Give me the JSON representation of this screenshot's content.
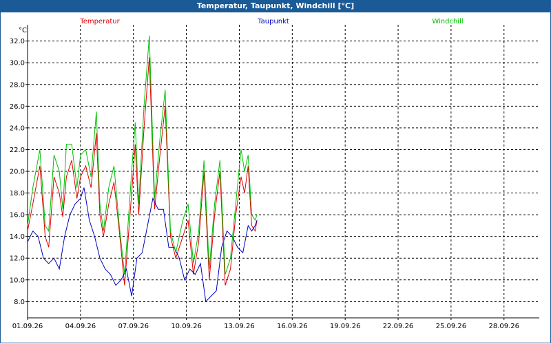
{
  "window": {
    "title": "Temperatur, Taupunkt, Windchill [°C]"
  },
  "chart_data": {
    "type": "line",
    "title": "Temperatur, Taupunkt, Windchill [°C]",
    "ylabel": "°C",
    "xlabel": "",
    "ylim": [
      6.5,
      33.5
    ],
    "xlim": [
      0,
      29
    ],
    "grid": true,
    "legend_placement": "top",
    "yticks": [
      "8.0",
      "10.0",
      "12.0",
      "14.0",
      "16.0",
      "18.0",
      "20.0",
      "22.0",
      "24.0",
      "26.0",
      "28.0",
      "30.0",
      "32.0"
    ],
    "ytick_values": [
      8,
      10,
      12,
      14,
      16,
      18,
      20,
      22,
      24,
      26,
      28,
      30,
      32
    ],
    "xticks": [
      "01.09.26",
      "04.09.26",
      "07.09.26",
      "10.09.26",
      "13.09.26",
      "16.09.26",
      "19.09.26",
      "22.09.26",
      "25.09.26",
      "28.09.26"
    ],
    "xtick_values": [
      0,
      3,
      6,
      9,
      12,
      15,
      18,
      21,
      24,
      27
    ],
    "series": [
      {
        "name": "Temperatur",
        "color": "#e00000",
        "x": [
          0,
          0.3,
          0.7,
          1.0,
          1.2,
          1.5,
          1.8,
          2.0,
          2.2,
          2.5,
          2.8,
          3.0,
          3.3,
          3.6,
          3.9,
          4.1,
          4.3,
          4.6,
          4.9,
          5.2,
          5.5,
          5.9,
          6.1,
          6.3,
          6.6,
          6.9,
          7.2,
          7.5,
          7.8,
          8.1,
          8.4,
          8.8,
          9.1,
          9.4,
          9.7,
          10.0,
          10.3,
          10.6,
          10.9,
          11.2,
          11.5,
          11.8,
          12.1,
          12.3,
          12.5,
          12.7,
          12.9,
          13.0
        ],
        "values": [
          14.5,
          17,
          20.5,
          14,
          13,
          19.5,
          18,
          15.8,
          19.5,
          21,
          17.5,
          19.5,
          20.5,
          18.5,
          23.5,
          16,
          14,
          17,
          19,
          14.5,
          9.5,
          18,
          22.5,
          16,
          24,
          30.5,
          16.5,
          21.5,
          26,
          14,
          12,
          14,
          15.5,
          10.5,
          13.5,
          20,
          10,
          16,
          20,
          9.5,
          11,
          16,
          19.5,
          18,
          20.5,
          15,
          14.5,
          15.5
        ]
      },
      {
        "name": "Taupunkt",
        "color": "#0000c0",
        "x": [
          0,
          0.3,
          0.6,
          0.9,
          1.2,
          1.5,
          1.8,
          2.1,
          2.4,
          2.7,
          3.0,
          3.2,
          3.5,
          3.8,
          4.1,
          4.4,
          4.7,
          5.0,
          5.3,
          5.6,
          5.9,
          6.2,
          6.5,
          6.8,
          7.1,
          7.4,
          7.7,
          8.0,
          8.3,
          8.6,
          8.9,
          9.2,
          9.5,
          9.8,
          10.1,
          10.4,
          10.7,
          11.0,
          11.3,
          11.6,
          11.9,
          12.2,
          12.5,
          12.7,
          12.9,
          13.0
        ],
        "values": [
          13.5,
          14.5,
          14,
          12,
          11.5,
          12,
          11,
          14,
          16,
          17,
          17.5,
          18.5,
          15.5,
          14,
          12,
          11,
          10.5,
          9.5,
          10,
          11,
          8.5,
          12,
          12.5,
          15,
          17.5,
          16.5,
          16.5,
          13,
          13,
          12,
          10,
          11,
          10.5,
          11.5,
          8,
          8.5,
          9,
          13,
          14.5,
          14,
          13,
          12.5,
          15,
          14.5,
          15,
          15.5
        ]
      },
      {
        "name": "Windchill",
        "color": "#00c000",
        "x": [
          0,
          0.3,
          0.7,
          1.0,
          1.2,
          1.5,
          1.8,
          2.0,
          2.2,
          2.5,
          2.8,
          3.0,
          3.3,
          3.6,
          3.9,
          4.1,
          4.3,
          4.6,
          4.9,
          5.2,
          5.5,
          5.9,
          6.1,
          6.3,
          6.6,
          6.9,
          7.2,
          7.5,
          7.8,
          8.1,
          8.4,
          8.8,
          9.1,
          9.4,
          9.7,
          10.0,
          10.3,
          10.6,
          10.9,
          11.2,
          11.5,
          11.8,
          12.1,
          12.3,
          12.5,
          12.7,
          12.9,
          13.0
        ],
        "values": [
          15,
          18.5,
          22,
          15,
          14.5,
          21.5,
          20,
          16.5,
          22.5,
          22.5,
          18.5,
          21.5,
          22,
          19.5,
          25.5,
          17,
          14.5,
          18.5,
          20.5,
          15,
          10.5,
          20,
          24.5,
          17,
          26,
          32.5,
          17.5,
          23,
          27.5,
          14.5,
          12.5,
          15.5,
          17,
          11.5,
          14.5,
          21,
          11,
          17,
          21,
          10.5,
          12,
          17,
          22,
          20,
          21.5,
          16,
          15.5,
          16
        ]
      }
    ]
  }
}
